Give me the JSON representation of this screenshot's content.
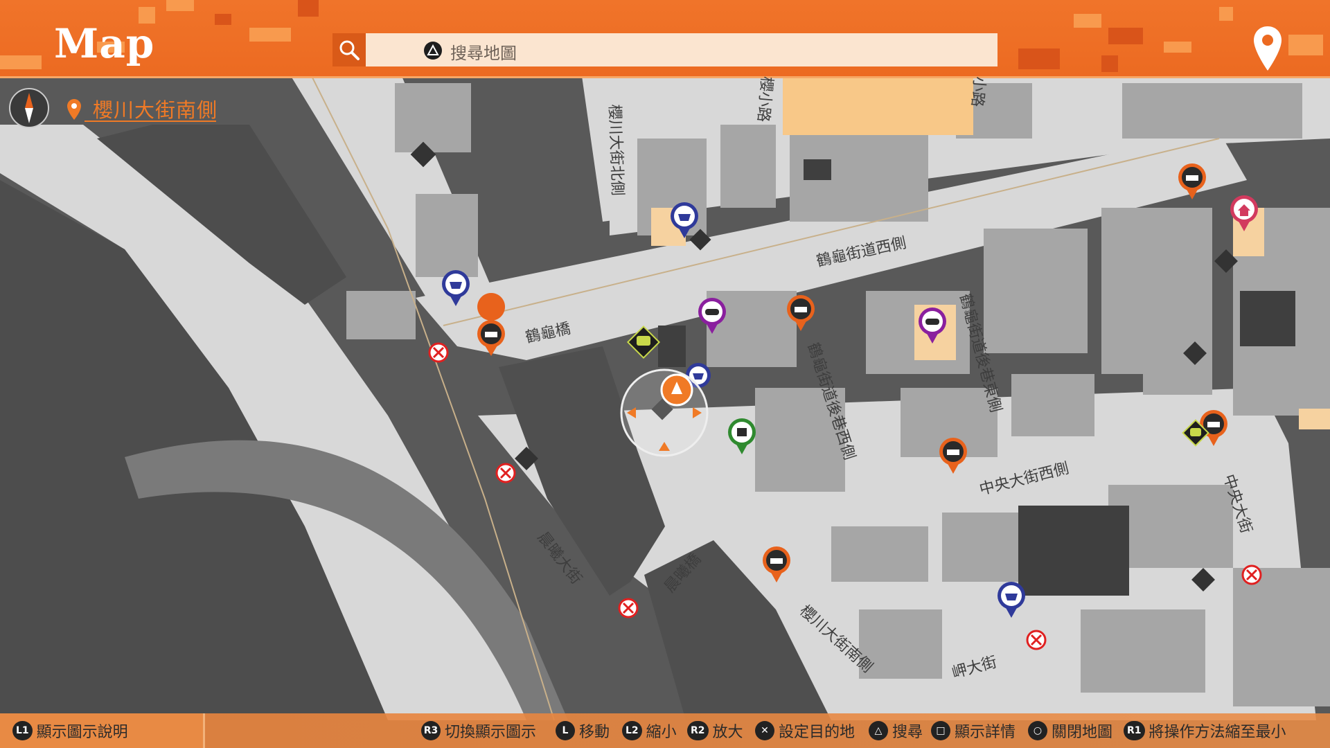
{
  "header": {
    "title": "Map",
    "search_placeholder": "搜尋地圖",
    "accent": "#ec6a21"
  },
  "location": {
    "name": "櫻川大街南側"
  },
  "streets": {
    "s1": "鶴龜街道西側",
    "s2": "鶴龜橋",
    "s3": "櫻川大街北側",
    "s4": "櫻小路",
    "s5": "小路",
    "s6": "鶴龜街道後巷東側",
    "s7": "鶴龜街道後巷西側",
    "s8": "中央大街西側",
    "s9": "中央大街",
    "s10": "晨曦大街",
    "s11": "晨曦橋",
    "s12": "櫻川大街南側",
    "s13": "岬大街"
  },
  "footer": {
    "legend_btn": "L1",
    "legend_label": "顯示圖示說明",
    "h1_btn": "R3",
    "h1_label": "切換顯示圖示",
    "h2_btn": "L",
    "h2_label": "移動",
    "h3_btn": "L2",
    "h3_label": "縮小",
    "h4_btn": "R2",
    "h4_label": "放大",
    "h5_label": "設定目的地",
    "h6_label": "搜尋",
    "h7_label": "顯示詳情",
    "h8_label": "關閉地圖",
    "h9_btn": "R1",
    "h9_label": "將操作方法縮至最小"
  },
  "colors": {
    "taxi": "#e8621c",
    "shop": "#2f3a9a",
    "game": "#8a1f9e",
    "home": "#d23a5e",
    "atm": "#2f8a2f",
    "blocked": "#e02020"
  }
}
